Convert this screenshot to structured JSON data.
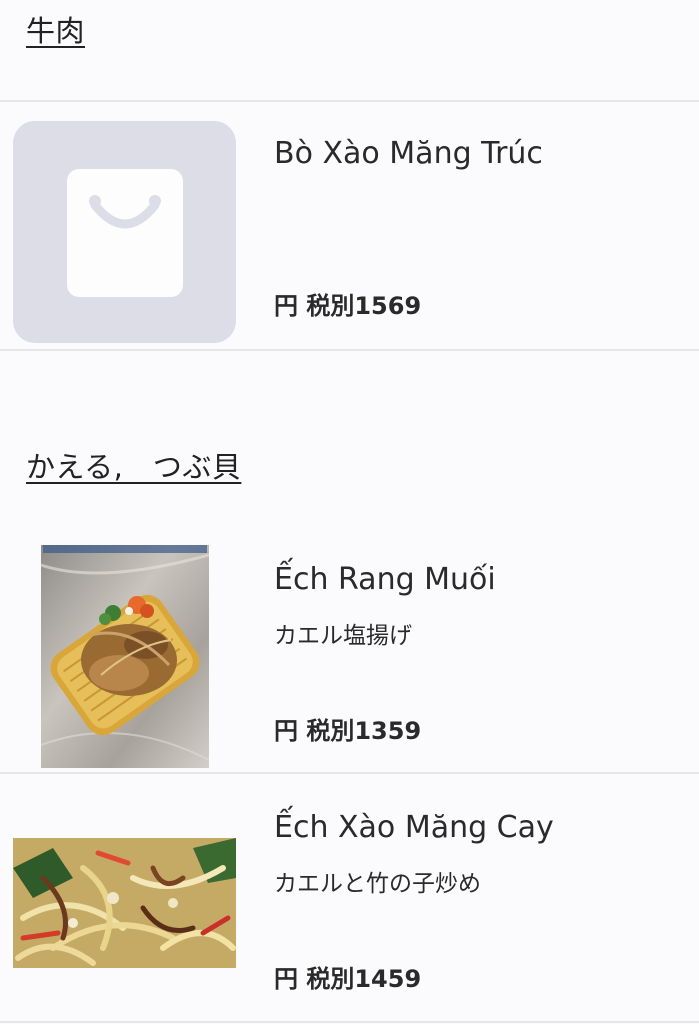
{
  "categories": [
    {
      "title": "牛肉",
      "items": [
        {
          "name": "Bò Xào Măng Trúc",
          "subtitle": "",
          "price": "円 税別1569",
          "image": "shopping-bag-placeholder-icon"
        }
      ]
    },
    {
      "title": "かえる,　つぶ貝",
      "items": [
        {
          "name": "Ếch Rang Muối",
          "subtitle": "カエル塩揚げ",
          "price": "円 税別1359",
          "image": "fried-frog-photo"
        },
        {
          "name": "Ếch Xào Măng Cay",
          "subtitle": "カエルと竹の子炒め",
          "price": "円 税別1459",
          "image": "stir-fried-frog-bamboo-photo"
        }
      ]
    }
  ],
  "colors": {
    "background": "#fbfbfd",
    "divider": "#e6e6ea",
    "placeholder": "#dcdde7",
    "text": "#2a2a2a"
  }
}
